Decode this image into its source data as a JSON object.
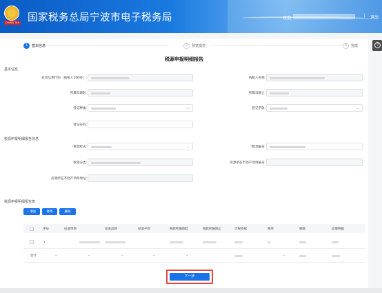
{
  "header": {
    "site_title": "国家税务总局宁波市电子税务局",
    "logo_ribbon": "CHINA TAX",
    "welcome": "欢迎,",
    "separator": "|",
    "logout": "退出"
  },
  "help_icon": "?",
  "steps": [
    {
      "num": "1",
      "label": "基本信息",
      "active": true
    },
    {
      "num": "2",
      "label": "预览提交",
      "active": false
    },
    {
      "num": "3",
      "label": "完成",
      "active": false
    }
  ],
  "page_title": "税源申报明细报告",
  "basic_info": {
    "section_title": "基本信息",
    "fields": {
      "credit_code": "社会信用代码（纳税人识别号）:",
      "taxpayer_name": "纳税人名称:",
      "start_date": "所属日期起:",
      "end_date": "所属日期止:",
      "cert_type": "登记种类:",
      "cert_kind": "登记字轨:",
      "cert_no": "登记号码:"
    }
  },
  "detail_info": {
    "section_title": "税源申报明细报告信息",
    "fields": {
      "source_mark": "税源标志:",
      "source_no": "税源编号:",
      "source_type": "税源分类:",
      "property_project_no": "房源所在不动产项目编号:",
      "property_address": "房源所在不动产项目地址:"
    }
  },
  "detail_table": {
    "section_title": "税源申报明细报告表",
    "buttons": {
      "add": "+ 增加",
      "edit": "修改",
      "delete": "删除"
    },
    "columns": [
      "序号",
      "征收项目",
      "征收品目",
      "征收子目",
      "税款所属期起",
      "税款所属期止",
      "计税依据",
      "税率",
      "税额",
      "应缴税额"
    ],
    "rows": [
      {
        "index": "1"
      }
    ],
    "total_label": "合计",
    "total_dashes": [
      "--",
      "--",
      "--",
      "--",
      "--",
      "--"
    ]
  },
  "footer": {
    "next_button": "下一步"
  }
}
